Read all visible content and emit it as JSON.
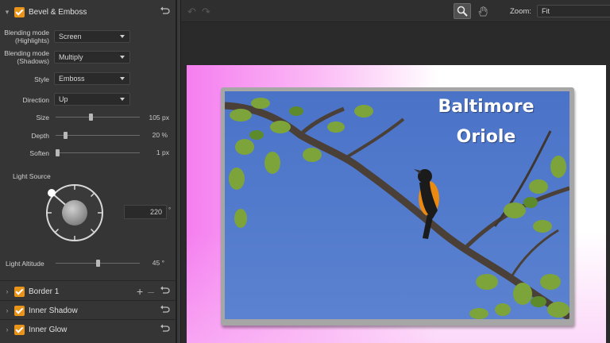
{
  "panel": {
    "bevel": {
      "title": "Bevel & Emboss",
      "blending_highlights_label": "Blending mode\n(Highlights)",
      "blending_highlights_value": "Screen",
      "blending_shadows_label": "Blending mode\n(Shadows)",
      "blending_shadows_value": "Multiply",
      "style_label": "Style",
      "style_value": "Emboss",
      "direction_label": "Direction",
      "direction_value": "Up",
      "size_label": "Size",
      "size_value": "105 px",
      "size_fraction": 0.42,
      "depth_label": "Depth",
      "depth_value": "20 %",
      "depth_fraction": 0.1,
      "soften_label": "Soften",
      "soften_value": "1 px",
      "soften_fraction": 0.0,
      "light_source_label": "Light Source",
      "light_angle_value": "220",
      "light_angle_unit": "°",
      "light_altitude_label": "Light Altitude",
      "light_altitude_value": "45 °",
      "light_altitude_fraction": 0.5
    },
    "sections": [
      {
        "title": "Border 1"
      },
      {
        "title": "Inner Shadow"
      },
      {
        "title": "Inner Glow"
      }
    ]
  },
  "toolbar": {
    "zoom_label": "Zoom:",
    "zoom_value": "Fit"
  },
  "canvas": {
    "title_line1": "Baltimore",
    "title_line2": "Oriole"
  },
  "colors": {
    "accent": "#e8941a"
  }
}
